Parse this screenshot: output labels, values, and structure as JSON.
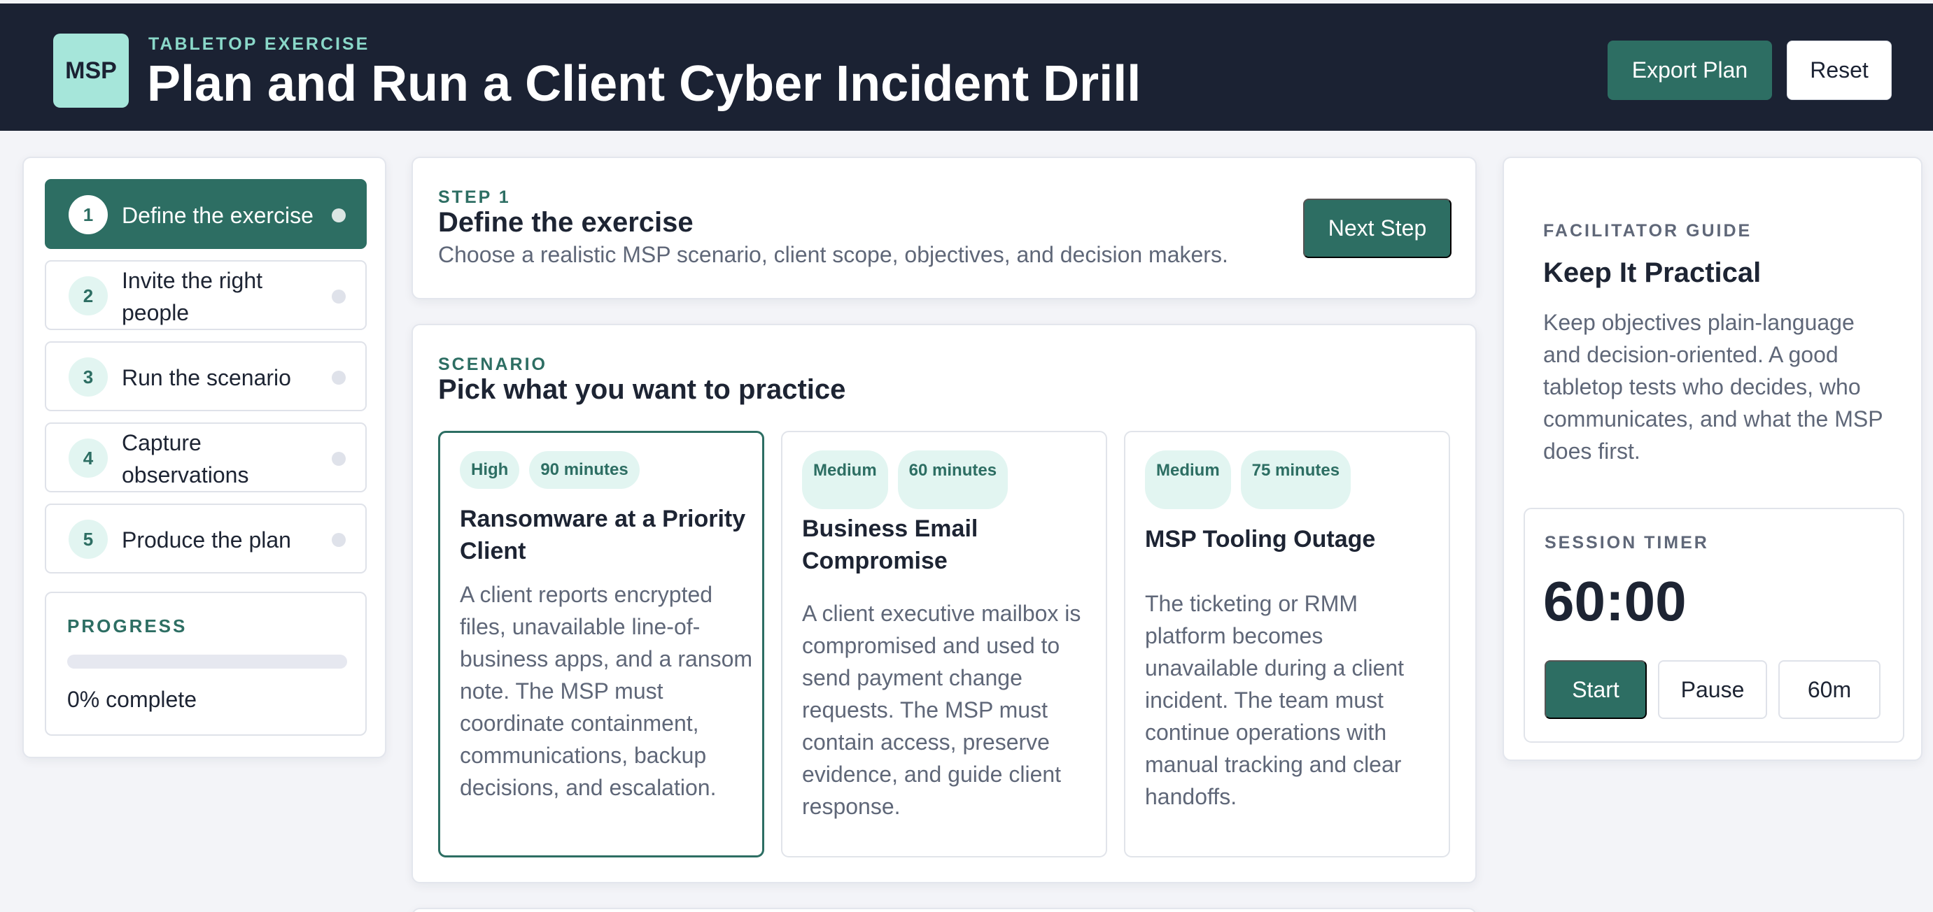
{
  "header": {
    "logo": "MSP",
    "eyebrow": "TABLETOP EXERCISE",
    "title": "Plan and Run a Client Cyber Incident Drill",
    "export_label": "Export Plan",
    "reset_label": "Reset"
  },
  "steps": [
    {
      "num": "1",
      "label": "Define the exercise",
      "active": true
    },
    {
      "num": "2",
      "label": "Invite the right people",
      "active": false
    },
    {
      "num": "3",
      "label": "Run the scenario",
      "active": false
    },
    {
      "num": "4",
      "label": "Capture observations",
      "active": false
    },
    {
      "num": "5",
      "label": "Produce the plan",
      "active": false
    }
  ],
  "progress": {
    "title": "PROGRESS",
    "value": 0,
    "text": "0% complete"
  },
  "step_header": {
    "eyebrow": "STEP 1",
    "title": "Define the exercise",
    "subtitle": "Choose a realistic MSP scenario, client scope, objectives, and decision makers.",
    "next_label": "Next Step"
  },
  "scenario": {
    "eyebrow": "SCENARIO",
    "title": "Pick what you want to practice",
    "options": [
      {
        "severity": "High",
        "duration": "90 minutes",
        "title": "Ransomware at a Priority Client",
        "description": "A client reports encrypted files, unavailable line-of-business apps, and a ransom note. The MSP must coordinate containment, communications, backup decisions, and escalation.",
        "selected": true
      },
      {
        "severity": "Medium",
        "duration": "60 minutes",
        "title": "Business Email Compromise",
        "description": "A client executive mailbox is compromised and used to send payment change requests. The MSP must contain access, preserve evidence, and guide client response.",
        "selected": false
      },
      {
        "severity": "Medium",
        "duration": "75 minutes",
        "title": "MSP Tooling Outage",
        "description": "The ticketing or RMM platform becomes unavailable during a client incident. The team must continue operations with manual tracking and clear handoffs.",
        "selected": false
      }
    ]
  },
  "guide": {
    "eyebrow": "FACILITATOR GUIDE",
    "title": "Keep It Practical",
    "text": "Keep objectives plain-language and decision-oriented. A good tabletop tests who decides, who communicates, and what the MSP does first."
  },
  "timer": {
    "eyebrow": "SESSION TIMER",
    "time": "60:00",
    "start_label": "Start",
    "pause_label": "Pause",
    "duration_label": "60m"
  },
  "colors": {
    "header_bg": "#1b2233",
    "accent": "#2d6e63",
    "logo_bg": "#a6e6da",
    "tag_bg": "#e2f5f1",
    "page_bg": "#f3f4f8"
  }
}
